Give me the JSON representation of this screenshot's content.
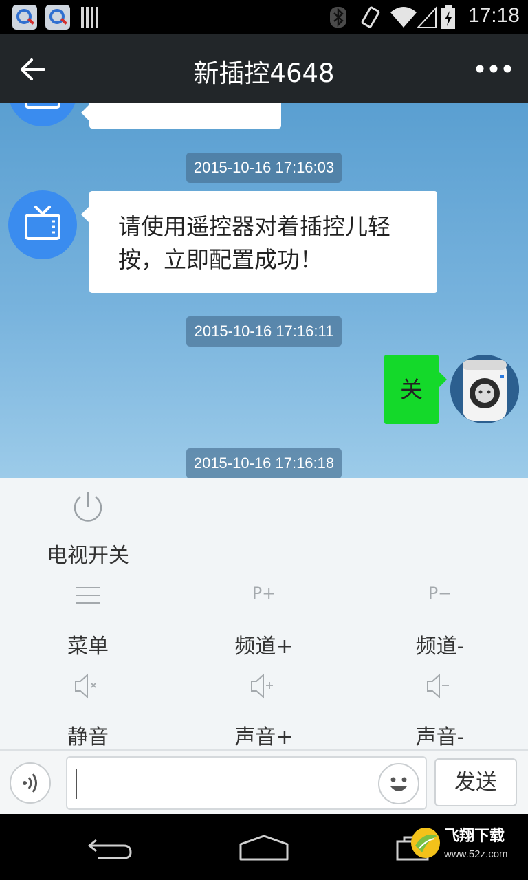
{
  "status_bar": {
    "time": "17:18",
    "left_icons": [
      "app-notification-icon",
      "app-notification-icon",
      "barcode-icon"
    ],
    "right_icons": [
      "bluetooth-icon",
      "vibrate-icon",
      "wifi-icon",
      "signal-icon",
      "battery-charging-icon"
    ]
  },
  "header": {
    "title": "新插控4648",
    "back_icon": "back-arrow-icon",
    "more_icon": "more-dots-icon"
  },
  "chat": {
    "partial_message": "",
    "messages": [
      {
        "timestamp": "2015-10-16 17:16:03",
        "sender": "tv",
        "text": "请使用遥控器对着插控儿轻按，立即配置成功！"
      },
      {
        "timestamp": "2015-10-16 17:16:11",
        "sender": "plug",
        "text": "关"
      },
      {
        "timestamp": "2015-10-16 17:16:18"
      }
    ]
  },
  "remote": {
    "buttons": [
      {
        "label": "电视开关",
        "icon": "power-icon"
      },
      {
        "label": "菜单",
        "icon": "menu-lines-icon"
      },
      {
        "label": "频道+",
        "icon": "channel-plus-icon",
        "icon_text": "P+"
      },
      {
        "label": "频道-",
        "icon": "channel-minus-icon",
        "icon_text": "P−"
      },
      {
        "label": "静音",
        "icon": "mute-icon"
      },
      {
        "label": "声音+",
        "icon": "volume-up-icon"
      },
      {
        "label": "声音-",
        "icon": "volume-down-icon"
      }
    ]
  },
  "input": {
    "placeholder": "",
    "send_label": "发送"
  },
  "watermark": {
    "text": "飞翔下载",
    "url": "www.52z.com"
  },
  "colors": {
    "header_bg": "#222629",
    "tv_avatar": "#3a8cef",
    "sent_bubble": "#14d92a"
  }
}
